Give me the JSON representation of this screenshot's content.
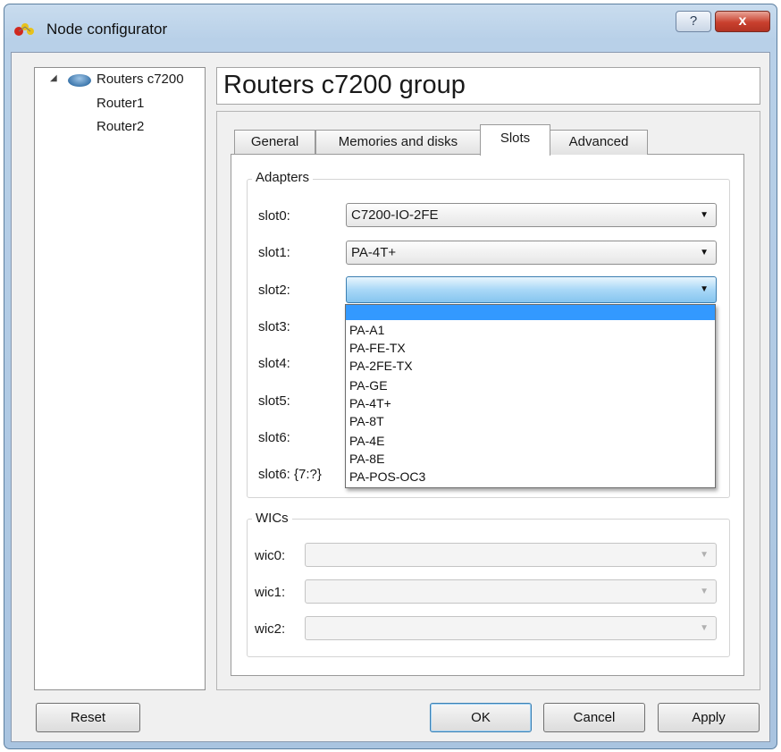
{
  "window": {
    "title": "Node configurator",
    "help_label": "?",
    "close_label": "x"
  },
  "tree": {
    "group": {
      "label": "Routers c7200",
      "expand_glyph": "◢"
    },
    "children": [
      "Router1",
      "Router2"
    ]
  },
  "header": {
    "title": "Routers c7200 group"
  },
  "tabs": [
    "General",
    "Memories and disks",
    "Slots",
    "Advanced"
  ],
  "active_tab": "Slots",
  "adapters": {
    "title": "Adapters",
    "slots": [
      {
        "label": "slot0:",
        "value": "C7200-IO-2FE"
      },
      {
        "label": "slot1:",
        "value": "PA-4T+"
      },
      {
        "label": "slot2:",
        "value": ""
      },
      {
        "label": "slot3:"
      },
      {
        "label": "slot4:"
      },
      {
        "label": "slot5:"
      },
      {
        "label": "slot6:"
      },
      {
        "label": "slot6: {7:?}"
      }
    ]
  },
  "dropdown": {
    "options": [
      "",
      "PA-A1",
      "PA-FE-TX",
      "PA-2FE-TX",
      "PA-GE",
      "PA-4T+",
      "PA-8T",
      "PA-4E",
      "PA-8E",
      "PA-POS-OC3"
    ],
    "highlighted_index": 0
  },
  "wics": {
    "title": "WICs",
    "items": [
      {
        "label": "wic0:",
        "value": ""
      },
      {
        "label": "wic1:",
        "value": ""
      },
      {
        "label": "wic2:",
        "value": ""
      }
    ]
  },
  "buttons": {
    "reset": "Reset",
    "ok": "OK",
    "cancel": "Cancel",
    "apply": "Apply"
  },
  "colors": {
    "selection": "#3399ff",
    "focus_border": "#3c7fb1",
    "title_bar": "#b8d0e8"
  },
  "icons": {
    "app": "node-configurator-icon",
    "router": "router-icon",
    "combo_arrow": "dropdown-arrow-icon"
  }
}
